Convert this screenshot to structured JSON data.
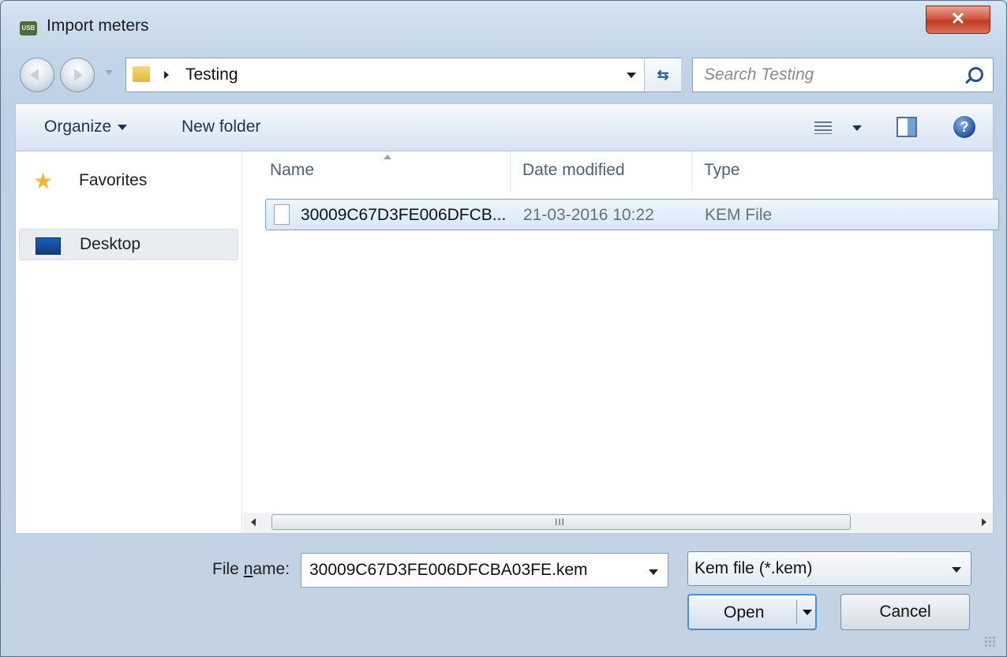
{
  "window": {
    "title": "Import meters",
    "app_icon_text": "USB",
    "close_glyph": "✕"
  },
  "nav": {
    "breadcrumb": "Testing",
    "refresh_glyph": "⇆"
  },
  "search": {
    "placeholder": "Search Testing"
  },
  "toolbar": {
    "organize_label": "Organize",
    "new_folder_label": "New folder",
    "help_glyph": "?"
  },
  "sidebar": {
    "favorites_label": "Favorites",
    "desktop_label": "Desktop"
  },
  "columns": {
    "name": "Name",
    "date_modified": "Date modified",
    "type": "Type"
  },
  "files": [
    {
      "name": "30009C67D3FE006DFCB...",
      "date_modified": "21-03-2016 10:22",
      "type": "KEM File"
    }
  ],
  "scrollbar": {
    "grip": "III"
  },
  "footer": {
    "file_name_label_prefix": "File ",
    "file_name_label_underlined": "n",
    "file_name_label_suffix": "ame:",
    "file_name_value": "30009C67D3FE006DFCBA03FE.kem",
    "filter_value": "Kem file (*.kem)",
    "open_label": "Open",
    "cancel_label": "Cancel"
  },
  "icons": {
    "app": "usb-app-icon",
    "back": "back-arrow-icon",
    "forward": "forward-arrow-icon",
    "folder": "folder-icon",
    "search": "search-icon",
    "views": "views-icon",
    "preview_pane": "preview-pane-icon",
    "help": "help-icon",
    "favorites": "star-icon",
    "desktop": "desktop-icon",
    "file": "file-icon"
  },
  "colors": {
    "accent": "#4a90d0",
    "selection": "#d7e8f8",
    "close_button": "#c1391f"
  }
}
